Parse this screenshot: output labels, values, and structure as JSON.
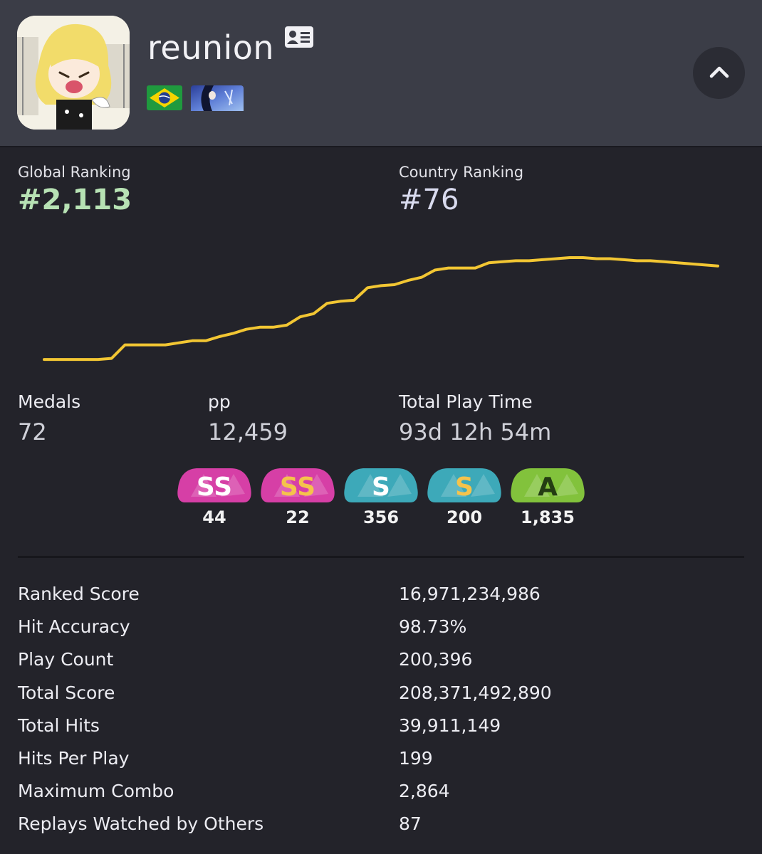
{
  "profile": {
    "username": "reunion",
    "flag": "brazil-flag",
    "team_badge": "team-flag-icon",
    "card_icon": "profile-card-icon",
    "collapse_icon": "chevron-up-icon"
  },
  "rankings": {
    "global_label": "Global Ranking",
    "global_value": "#2,113",
    "country_label": "Country Ranking",
    "country_value": "#76",
    "global_color": "#b7e2b4"
  },
  "chart_data": {
    "type": "line",
    "title": "",
    "xlabel": "",
    "ylabel": "",
    "grid": false,
    "line_color": "#f2c633",
    "series": [
      {
        "values": [
          2,
          2,
          2,
          2,
          2,
          3,
          16,
          16,
          16,
          16,
          18,
          20,
          20,
          24,
          27,
          31,
          33,
          33,
          35,
          43,
          46,
          56,
          58,
          59,
          71,
          73,
          74,
          78,
          81,
          88,
          90,
          90,
          90,
          95,
          96,
          97,
          97,
          98,
          99,
          100,
          100,
          99,
          99,
          98,
          97,
          97,
          96,
          95,
          94,
          93,
          92
        ]
      }
    ]
  },
  "stats": {
    "medals_label": "Medals",
    "medals_value": "72",
    "pp_label": "pp",
    "pp_value": "12,459",
    "playtime_label": "Total Play Time",
    "playtime_value": "93d 12h 54m"
  },
  "grades": [
    {
      "grade": "SS",
      "variant": "silver",
      "count": "44",
      "bg": "#d63fa6",
      "text": "#ffffff"
    },
    {
      "grade": "SS",
      "variant": "gold",
      "count": "22",
      "bg": "#d63fa6",
      "text": "#f5c34b"
    },
    {
      "grade": "S",
      "variant": "silver",
      "count": "356",
      "bg": "#3da9b9",
      "text": "#ffffff"
    },
    {
      "grade": "S",
      "variant": "gold",
      "count": "200",
      "bg": "#3da9b9",
      "text": "#f5c34b"
    },
    {
      "grade": "A",
      "variant": "normal",
      "count": "1,835",
      "bg": "#82c23c",
      "text": "#243d13"
    }
  ],
  "details": [
    {
      "label": "Ranked Score",
      "value": "16,971,234,986"
    },
    {
      "label": "Hit Accuracy",
      "value": "98.73%"
    },
    {
      "label": "Play Count",
      "value": "200,396"
    },
    {
      "label": "Total Score",
      "value": "208,371,492,890"
    },
    {
      "label": "Total Hits",
      "value": "39,911,149"
    },
    {
      "label": "Hits Per Play",
      "value": "199"
    },
    {
      "label": "Maximum Combo",
      "value": "2,864"
    },
    {
      "label": "Replays Watched by Others",
      "value": "87"
    }
  ]
}
